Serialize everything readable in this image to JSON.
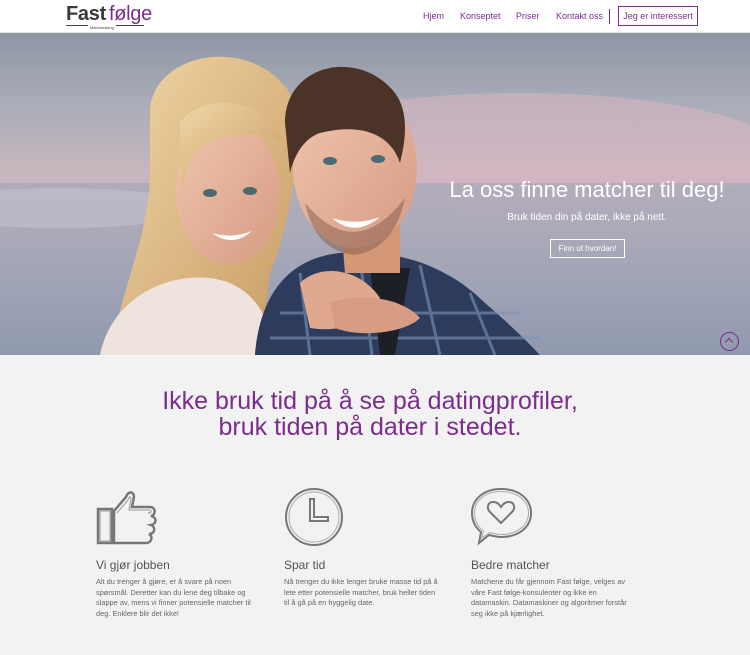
{
  "header": {
    "logo_fast": "Fast",
    "logo_folge": "følge",
    "logo_sub": "Matchmaking",
    "nav": [
      "Hjem",
      "Konseptet",
      "Priser",
      "Kontakt oss"
    ],
    "cta": "Jeg er interessert"
  },
  "hero": {
    "title": "La oss finne matcher til deg!",
    "subtitle": "Bruk tiden din på dater, ikke på nett.",
    "button": "Finn ut hvordan!"
  },
  "headline": {
    "line1": "Ikke bruk tid på å se på datingprofiler,",
    "line2": "bruk tiden på dater i stedet."
  },
  "features": [
    {
      "icon": "thumbs-up-icon",
      "title": "Vi gjør jobben",
      "text": "Alt du trenger å gjøre, er å svare på noen spørsmål. Deretter kan du lene deg tilbake og slappe av, mens vi finner potensielle matcher til deg. Enklere blir det ikke!"
    },
    {
      "icon": "clock-icon",
      "title": "Spar tid",
      "text": "Nå trenger du ikke lenger bruke masse tid på å lete etter potensielle matcher, bruk heller tiden til å gå på en hyggelig date."
    },
    {
      "icon": "heart-bubble-icon",
      "title": "Bedre matcher",
      "text": "Matchene du får gjennom Fast følge, velges av våre Fast følge-konsulenter og ikke en datamaskin. Datamaskiner og algoritmer forstår seg ikke på kjærlighet."
    }
  ],
  "colors": {
    "accent": "#7b2d8e",
    "background": "#f2f2f2"
  }
}
